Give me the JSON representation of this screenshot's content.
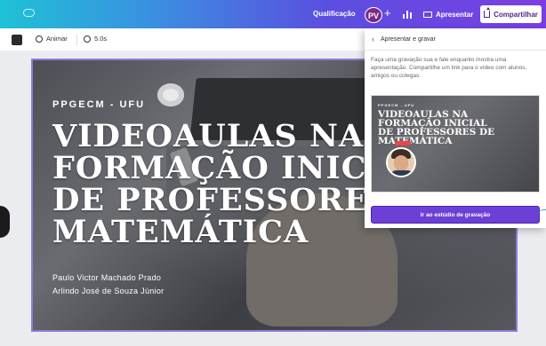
{
  "topbar": {
    "doc_title": "Qualificação",
    "avatar_initials": "PV",
    "present_label": "Apresentar",
    "share_label": "Compartilhar"
  },
  "toolbar": {
    "animate_label": "Animar",
    "duration_label": "5.0s",
    "swatch_color": "#2b2b2b"
  },
  "slide": {
    "kicker": "PPGECM - UFU",
    "title_lines": [
      "VIDEOAULAS NA",
      "FORMAÇÃO INICIAL",
      "DE PROFESSORES",
      "MATEMÁTICA"
    ],
    "authors": [
      "Paulo Victor Machado Prado",
      "Arlindo José de Souza Júnior"
    ]
  },
  "panel": {
    "header": "Apresentar e gravar",
    "description": "Faça uma gravação sua e fale enquanto mostra uma apresentação. Compartilhe um link para o vídeo com alunos, amigos ou colegas.",
    "preview_kicker": "PPGECM - UFU",
    "preview_title_lines": [
      "VIDEOAULAS NA",
      "FORMAÇÃO INICIAL",
      "DE PROFESSORES DE",
      "MATEMÁTICA"
    ],
    "button_label": "Ir ao estúdio de gravação"
  },
  "icons": [
    "cloud-icon",
    "bar-chart-icon",
    "present-screen-icon",
    "share-upload-icon",
    "animate-icon",
    "timer-icon",
    "back-arrow-icon"
  ],
  "colors": {
    "topbar_gradient": [
      "#1ec2d6",
      "#5b4fe0",
      "#7b3ee3"
    ],
    "accent_purple": "#6c3fd6",
    "selection_border": "#8e7bd6"
  }
}
